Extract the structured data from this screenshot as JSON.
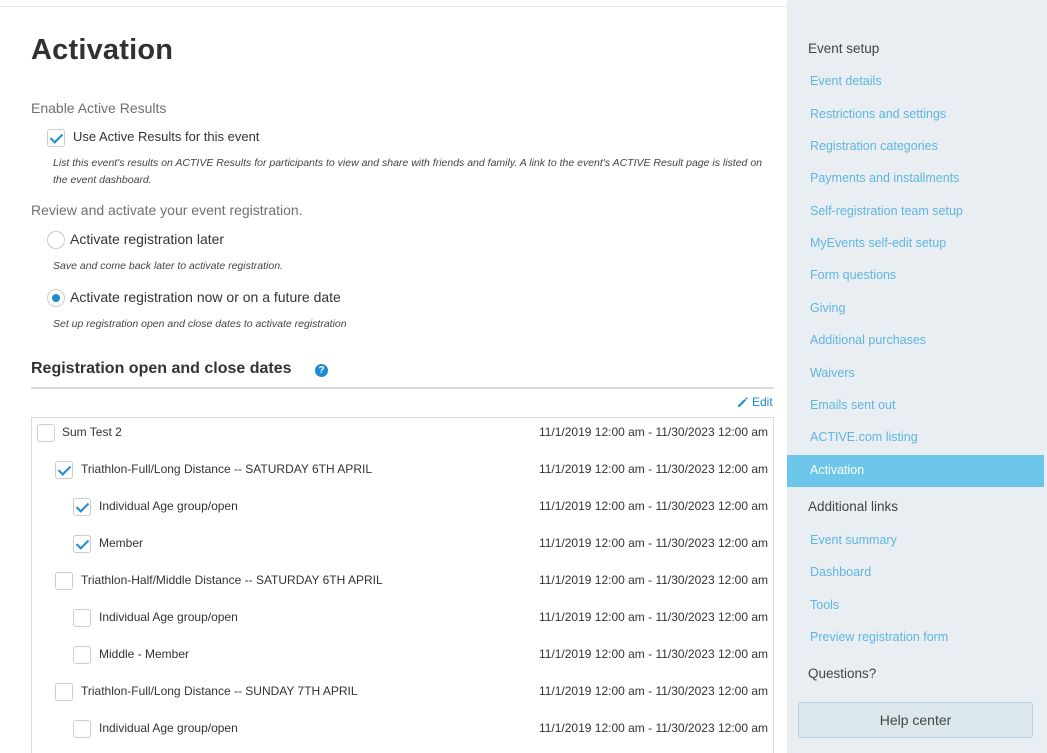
{
  "page": {
    "title": "Activation"
  },
  "active_results": {
    "section_label": "Enable Active Results",
    "checkbox_label": "Use Active Results for this event",
    "checked": true,
    "help_line1": "List this event's results on ACTIVE Results for participants to view and share with friends and family. A link to the event's ACTIVE Result page is listed on",
    "help_line2": "the event dashboard."
  },
  "activation": {
    "section_label": "Review and activate your event registration.",
    "option_later": {
      "label": "Activate registration later",
      "help": "Save and come back later to activate registration.",
      "selected": false
    },
    "option_now": {
      "label": "Activate registration now or on a future date",
      "help": "Set up registration open and close dates to activate registration",
      "selected": true
    }
  },
  "dates": {
    "title": "Registration open and close dates",
    "help_icon": "?",
    "edit_label": "Edit",
    "rows": [
      {
        "label": "Sum Test 2",
        "date": "11/1/2019 12:00 am - 11/30/2023 12:00 am",
        "checked": false,
        "level": 0
      },
      {
        "label": "Triathlon-Full/Long Distance -- SATURDAY 6TH APRIL",
        "date": "11/1/2019 12:00 am - 11/30/2023 12:00 am",
        "checked": true,
        "level": 1
      },
      {
        "label": "Individual Age group/open",
        "date": "11/1/2019 12:00 am - 11/30/2023 12:00 am",
        "checked": true,
        "level": 2
      },
      {
        "label": "Member",
        "date": "11/1/2019 12:00 am - 11/30/2023 12:00 am",
        "checked": true,
        "level": 2
      },
      {
        "label": "Triathlon-Half/Middle Distance -- SATURDAY 6TH APRIL",
        "date": "11/1/2019 12:00 am - 11/30/2023 12:00 am",
        "checked": false,
        "level": 1
      },
      {
        "label": "Individual Age group/open",
        "date": "11/1/2019 12:00 am - 11/30/2023 12:00 am",
        "checked": false,
        "level": 2
      },
      {
        "label": "Middle - Member",
        "date": "11/1/2019 12:00 am - 11/30/2023 12:00 am",
        "checked": false,
        "level": 2
      },
      {
        "label": "Triathlon-Full/Long Distance -- SUNDAY 7TH APRIL",
        "date": "11/1/2019 12:00 am - 11/30/2023 12:00 am",
        "checked": false,
        "level": 1
      },
      {
        "label": "Individual Age group/open",
        "date": "11/1/2019 12:00 am - 11/30/2023 12:00 am",
        "checked": false,
        "level": 2
      }
    ]
  },
  "sidebar": {
    "event_setup_heading": "Event setup",
    "event_setup_links": [
      "Event details",
      "Restrictions and settings",
      "Registration categories",
      "Payments and installments",
      "Self-registration team setup",
      "MyEvents self-edit setup",
      "Form questions",
      "Giving",
      "Additional purchases",
      "Waivers",
      "Emails sent out",
      "ACTIVE.com listing"
    ],
    "active_item": "Activation",
    "additional_heading": "Additional links",
    "additional_links": [
      "Event summary",
      "Dashboard",
      "Tools",
      "Preview registration form"
    ],
    "questions_heading": "Questions?",
    "help_button": "Help center"
  },
  "colors": {
    "accent": "#1c8bd2",
    "sidebar_link": "#5fb5e0",
    "sidebar_active": "#6cc6ea",
    "sidebar_bg": "#e9eef2"
  },
  "icons": {
    "check": "check-icon",
    "help": "question-circle-icon",
    "edit": "pencil-icon"
  }
}
